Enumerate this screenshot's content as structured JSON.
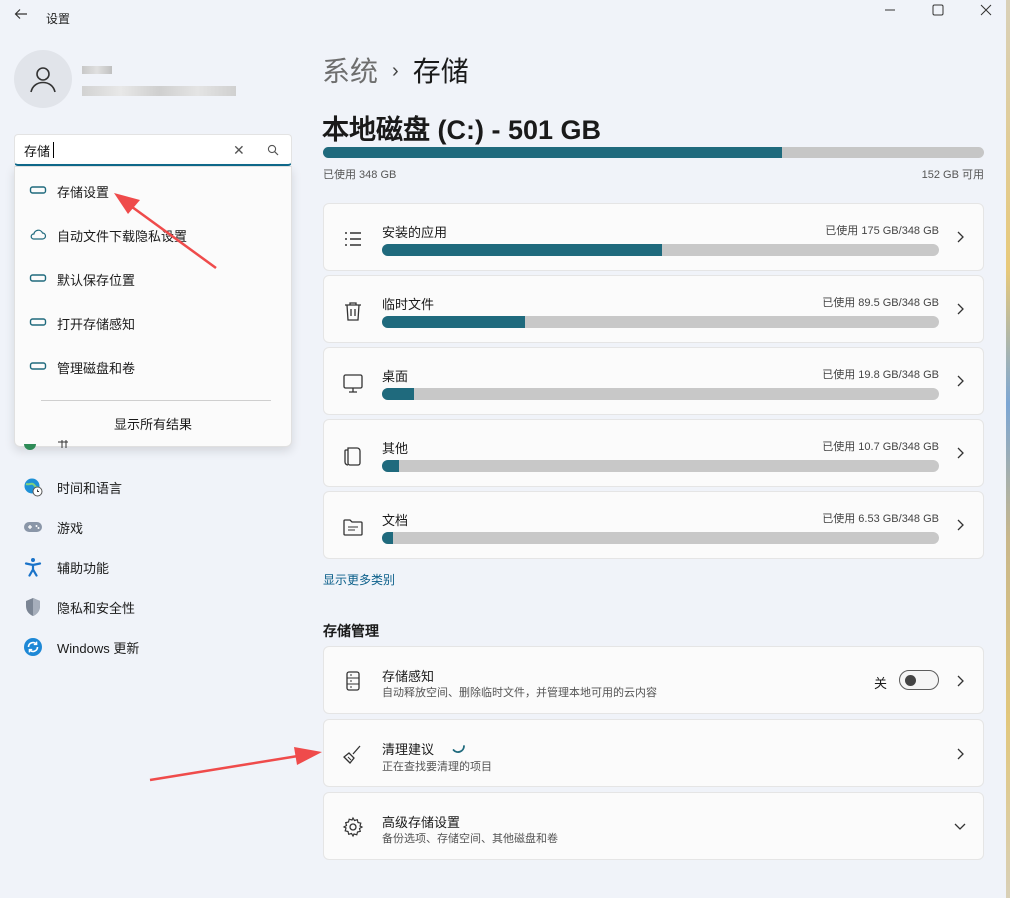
{
  "window": {
    "title": "设置",
    "back_icon": "back-arrow-icon",
    "controls": [
      "minimize-icon",
      "maximize-icon",
      "close-icon"
    ]
  },
  "profile": {
    "avatar_icon": "user-icon"
  },
  "search": {
    "value": "存储",
    "clear_icon": "close-icon",
    "search_icon": "search-icon",
    "results": [
      {
        "label": "存储设置",
        "icon": "storage-drive-icon"
      },
      {
        "label": "自动文件下载隐私设置",
        "icon": "cloud-icon"
      },
      {
        "label": "默认保存位置",
        "icon": "storage-drive-icon"
      },
      {
        "label": "打开存储感知",
        "icon": "storage-drive-icon"
      },
      {
        "label": "管理磁盘和卷",
        "icon": "storage-drive-icon"
      }
    ],
    "show_all": "显示所有结果"
  },
  "sidebar": {
    "items": [
      {
        "label": "时间和语言",
        "icon": "globe-clock-icon"
      },
      {
        "label": "游戏",
        "icon": "gamepad-icon"
      },
      {
        "label": "辅助功能",
        "icon": "accessibility-icon"
      },
      {
        "label": "隐私和安全性",
        "icon": "shield-icon"
      },
      {
        "label": "Windows 更新",
        "icon": "update-icon"
      }
    ]
  },
  "main": {
    "breadcrumb_parent": "系统",
    "breadcrumb_current": "存储",
    "disk_title": "本地磁盘 (C:) - 501 GB",
    "disk_used_label": "已使用 348 GB",
    "disk_free_label": "152 GB 可用",
    "disk_used_fraction": 0.695,
    "categories": [
      {
        "label": "安装的应用",
        "usage": "已使用 175 GB/348 GB",
        "fraction": 0.503,
        "icon": "apps-list-icon"
      },
      {
        "label": "临时文件",
        "usage": "已使用 89.5 GB/348 GB",
        "fraction": 0.257,
        "icon": "trash-icon"
      },
      {
        "label": "桌面",
        "usage": "已使用 19.8 GB/348 GB",
        "fraction": 0.057,
        "icon": "monitor-icon"
      },
      {
        "label": "其他",
        "usage": "已使用 10.7 GB/348 GB",
        "fraction": 0.031,
        "icon": "document-stack-icon"
      },
      {
        "label": "文档",
        "usage": "已使用 6.53 GB/348 GB",
        "fraction": 0.019,
        "icon": "folder-icon"
      }
    ],
    "show_more": "显示更多类别",
    "management_heading": "存储管理",
    "storage_sense": {
      "title": "存储感知",
      "subtitle": "自动释放空间、删除临时文件，并管理本地可用的云内容",
      "toggle_label": "关",
      "toggle_on": false,
      "icon": "storage-sense-icon"
    },
    "cleanup": {
      "title": "清理建议",
      "subtitle": "正在查找要清理的项目",
      "icon": "broom-icon"
    },
    "advanced": {
      "title": "高级存储设置",
      "subtitle": "备份选项、存储空间、其他磁盘和卷",
      "icon": "gear-icon"
    }
  },
  "colors": {
    "accent": "#1f6a7d",
    "link": "#0b5f8a",
    "background": "#f0f3f9",
    "annotation_arrow": "#ef4b4b"
  }
}
